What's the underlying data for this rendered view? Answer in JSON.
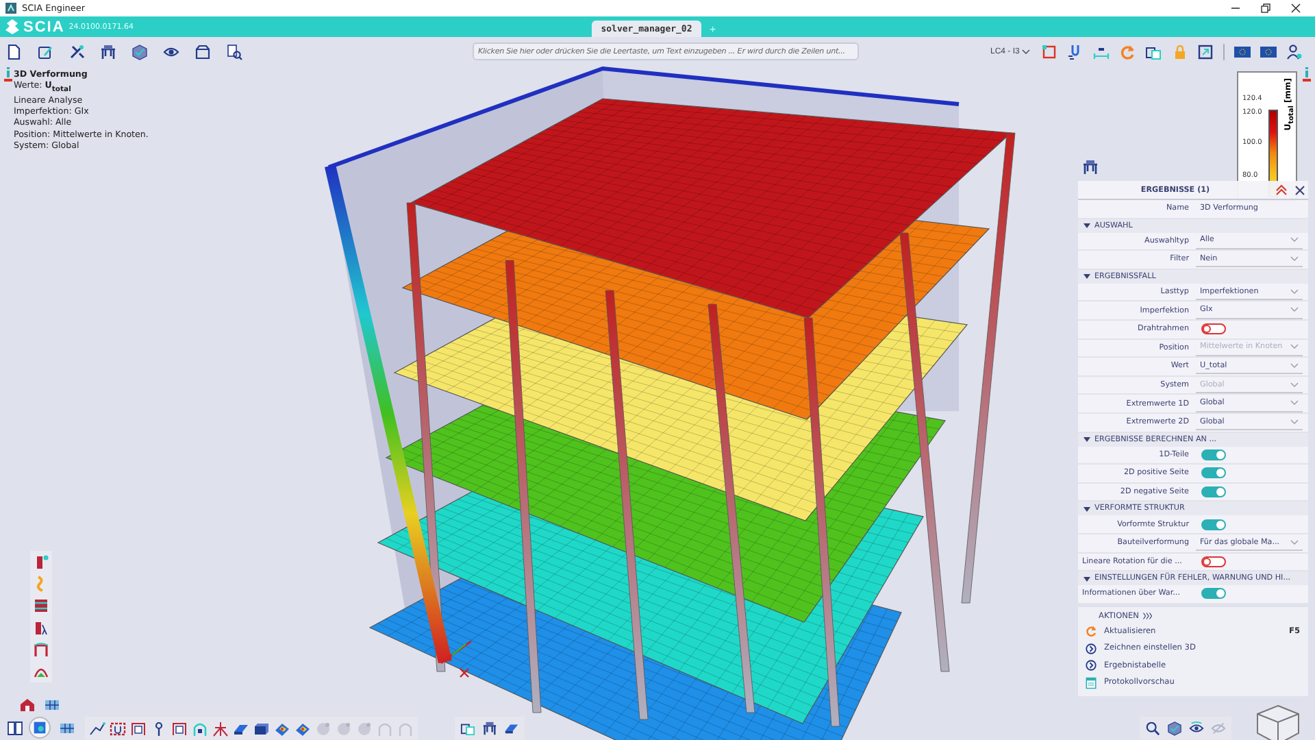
{
  "window": {
    "title": "SCIA Engineer"
  },
  "app_header": {
    "logo": "SCIA",
    "version": "24.0100.0171.64",
    "tabs": [
      {
        "label": "solver_manager_02",
        "selected": true
      }
    ],
    "new_tab": "+"
  },
  "toolbar": {
    "command_field": {
      "placeholder": "Klicken Sie hier oder drücken Sie die Leertaste, um Text einzugeben ... Er wird durch die Zeilen unt..."
    },
    "load_case": {
      "value": "LC4 - I3"
    }
  },
  "info": {
    "title": "3D Verformung",
    "lines": [
      "Werte: **U$_{total}$**",
      "Lineare Analyse",
      "Imperfektion: GIx",
      "Auswahl: Alle",
      "Position: Mittelwerte in Knoten.",
      "System: Global"
    ]
  },
  "legend": {
    "title": "U$_{total}$ [mm]",
    "labels": [
      "120.4",
      "120.0",
      "100.0",
      "80.0"
    ]
  },
  "results_panel": {
    "title": "ERGEBNISSE (1)",
    "rows": [
      {
        "kind": "field",
        "label": "Name",
        "value": "3D Verformung"
      },
      {
        "kind": "section",
        "label": "AUSWAHL",
        "expanded": true
      },
      {
        "kind": "select",
        "label": "Auswahltyp",
        "value": "Alle",
        "disabled": false
      },
      {
        "kind": "select",
        "label": "Filter",
        "value": "Nein",
        "disabled": false
      },
      {
        "kind": "section",
        "label": "ERGEBNISSFALL",
        "expanded": true
      },
      {
        "kind": "select",
        "label": "Lasttyp",
        "value": "Imperfektionen",
        "disabled": false
      },
      {
        "kind": "select",
        "label": "Imperfektion",
        "value": "GIx",
        "disabled": false
      },
      {
        "kind": "toggle",
        "label": "Drahtrahmen",
        "on": false
      },
      {
        "kind": "select",
        "label": "Position",
        "value": "Mittelwerte in Knoten",
        "disabled": true
      },
      {
        "kind": "select",
        "label": "Wert",
        "value": "U_total",
        "disabled": false
      },
      {
        "kind": "select",
        "label": "System",
        "value": "Global",
        "disabled": true
      },
      {
        "kind": "select",
        "label": "Extremwerte 1D",
        "value": "Global",
        "disabled": false
      },
      {
        "kind": "select",
        "label": "Extremwerte 2D",
        "value": "Global",
        "disabled": false
      },
      {
        "kind": "section",
        "label": "ERGEBNISSE BERECHNEN AN ...",
        "expanded": true
      },
      {
        "kind": "toggle",
        "label": "1D-Teile",
        "on": true
      },
      {
        "kind": "toggle",
        "label": "2D positive Seite",
        "on": true
      },
      {
        "kind": "toggle",
        "label": "2D negative Seite",
        "on": true
      },
      {
        "kind": "section",
        "label": "VERFORMTE STRUKTUR",
        "expanded": true
      },
      {
        "kind": "toggle",
        "label": "Vorformte Struktur",
        "on": true
      },
      {
        "kind": "select",
        "label": "Bauteilverformung",
        "value": "Für das globale Ma...",
        "disabled": false
      },
      {
        "kind": "toggle",
        "label": "Lineare Rotation für die ...",
        "on": false
      },
      {
        "kind": "section",
        "label": "EINSTELLUNGEN FÜR FEHLER, WARNUNG UND HI...",
        "expanded": true
      },
      {
        "kind": "toggle",
        "label": "Informationen über War...",
        "on": true
      }
    ]
  },
  "actions": {
    "title": "AKTIONEN",
    "items": [
      {
        "kind": "refresh",
        "label": "Aktualisieren",
        "shortcut": "F5"
      },
      {
        "kind": "open",
        "label": "Zeichnen einstellen 3D"
      },
      {
        "kind": "open",
        "label": "Ergebnistabelle"
      },
      {
        "kind": "report",
        "label": "Protokollvorschau"
      }
    ]
  }
}
